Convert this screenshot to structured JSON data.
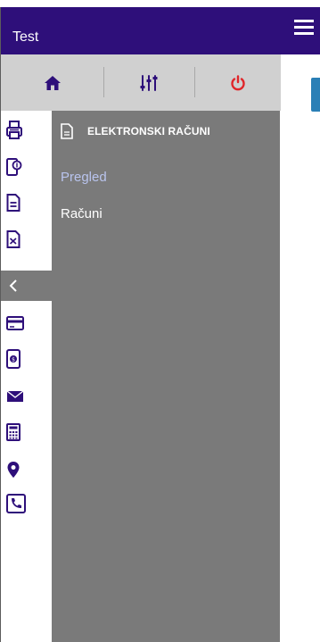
{
  "app": {
    "title": "Test"
  },
  "toolbar": {
    "home_icon": "home-icon",
    "filter_icon": "sliders-icon",
    "power_icon": "power-icon",
    "power_color": "#e0262a"
  },
  "rail": {
    "icons": [
      "printer-icon",
      "mobile-payment-icon",
      "document-icon",
      "document-exchange-icon",
      "chevron-left-icon",
      "credit-card-icon",
      "mobile-money-icon",
      "envelope-icon",
      "calculator-icon",
      "location-pin-icon",
      "phone-icon"
    ],
    "icon_color": "#2e0f7a"
  },
  "menu": {
    "header_label": "ELEKTRONSKI RAČUNI",
    "items": [
      {
        "label": "Pregled"
      },
      {
        "label": "Računi"
      }
    ]
  },
  "colors": {
    "brand": "#2e0f7a",
    "drawer_bg": "#7a7a7a",
    "toolbar_bg": "#d0d0d0",
    "accent_blue": "#2a7fb6"
  }
}
